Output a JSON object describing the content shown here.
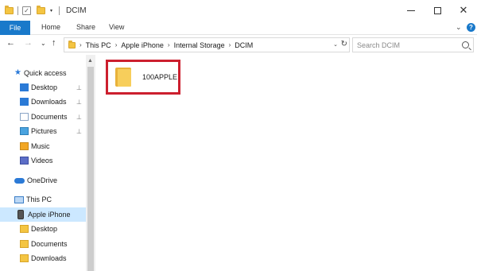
{
  "window": {
    "title": "DCIM",
    "minimize_glyph": "—",
    "close_glyph": "✕"
  },
  "quick_access_toolbar": {
    "check_glyph": "✓",
    "dropdown_glyph": "▾"
  },
  "ribbon": {
    "tabs": [
      {
        "label": "File"
      },
      {
        "label": "Home"
      },
      {
        "label": "Share"
      },
      {
        "label": "View"
      }
    ],
    "help_glyph": "?",
    "expand_glyph": "⌄"
  },
  "navigation": {
    "back_glyph": "←",
    "forward_glyph": "→",
    "recent_glyph": "⌄",
    "up_glyph": "↑"
  },
  "address_bar": {
    "breadcrumbs": [
      "This PC",
      "Apple iPhone",
      "Internal Storage",
      "DCIM"
    ],
    "separator": "›",
    "dropdown_glyph": "⌄",
    "refresh_glyph": "↻"
  },
  "search": {
    "placeholder": "Search DCIM"
  },
  "nav_pane": {
    "items": [
      {
        "label": "Quick access",
        "icon": "star-icon",
        "pinned": false
      },
      {
        "label": "Desktop",
        "icon": "desktop-folder-icon",
        "pinned": true
      },
      {
        "label": "Downloads",
        "icon": "downloads-folder-icon",
        "pinned": true
      },
      {
        "label": "Documents",
        "icon": "documents-folder-icon",
        "pinned": true
      },
      {
        "label": "Pictures",
        "icon": "pictures-folder-icon",
        "pinned": true
      },
      {
        "label": "Music",
        "icon": "music-folder-icon",
        "pinned": false
      },
      {
        "label": "Videos",
        "icon": "videos-folder-icon",
        "pinned": false
      },
      {
        "label": "OneDrive",
        "icon": "onedrive-cloud-icon",
        "pinned": false
      },
      {
        "label": "This PC",
        "icon": "computer-icon",
        "pinned": false
      },
      {
        "label": "Apple iPhone",
        "icon": "phone-icon",
        "pinned": false,
        "selected": true
      },
      {
        "label": "Desktop",
        "icon": "desktop-folder-icon",
        "pinned": false
      },
      {
        "label": "Documents",
        "icon": "documents-folder-icon",
        "pinned": false
      },
      {
        "label": "Downloads",
        "icon": "downloads-folder-icon",
        "pinned": false
      }
    ],
    "pin_glyph": "📌"
  },
  "scrollbar": {
    "up_glyph": "▲"
  },
  "content": {
    "items": [
      {
        "name": "100APPLE",
        "type": "folder",
        "highlighted": true
      }
    ]
  },
  "colors": {
    "accent": "#1979ca",
    "selection": "#cce8ff",
    "highlight_border": "#cc1f2e",
    "folder": "#f4c542"
  }
}
